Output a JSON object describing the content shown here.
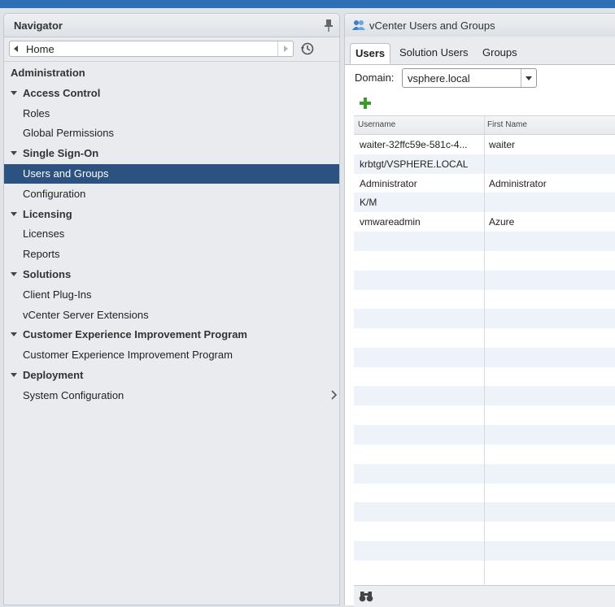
{
  "navigator": {
    "title": "Navigator",
    "home_label": "Home",
    "tree": [
      {
        "label": "Administration",
        "level": 0
      },
      {
        "label": "Access Control",
        "level": 1
      },
      {
        "label": "Roles",
        "level": 2
      },
      {
        "label": "Global Permissions",
        "level": 2
      },
      {
        "label": "Single Sign-On",
        "level": 1
      },
      {
        "label": "Users and Groups",
        "level": 2,
        "selected": true
      },
      {
        "label": "Configuration",
        "level": 2
      },
      {
        "label": "Licensing",
        "level": 1
      },
      {
        "label": "Licenses",
        "level": 2
      },
      {
        "label": "Reports",
        "level": 2
      },
      {
        "label": "Solutions",
        "level": 1
      },
      {
        "label": "Client Plug-Ins",
        "level": 2
      },
      {
        "label": "vCenter Server Extensions",
        "level": 2
      },
      {
        "label": "Customer Experience Improvement Program",
        "level": 1
      },
      {
        "label": "Customer Experience Improvement Program",
        "level": 2
      },
      {
        "label": "Deployment",
        "level": 1
      },
      {
        "label": "System Configuration",
        "level": 2
      }
    ]
  },
  "panel": {
    "title": "vCenter Users and Groups",
    "tabs": [
      {
        "label": "Users",
        "active": true
      },
      {
        "label": "Solution Users"
      },
      {
        "label": "Groups"
      }
    ],
    "domain_label": "Domain:",
    "domain_value": "vsphere.local",
    "columns": [
      "Username",
      "First Name"
    ],
    "rows": [
      [
        "waiter-32ffc59e-581c-4...",
        "waiter"
      ],
      [
        "krbtgt/VSPHERE.LOCAL",
        ""
      ],
      [
        "Administrator",
        "Administrator"
      ],
      [
        "K/M",
        ""
      ],
      [
        "vmwareadmin",
        "Azure"
      ]
    ]
  },
  "colors": {
    "selected": "#2b5280",
    "add_icon": "#3a9b2a",
    "row_alt": "#eef3f9"
  }
}
